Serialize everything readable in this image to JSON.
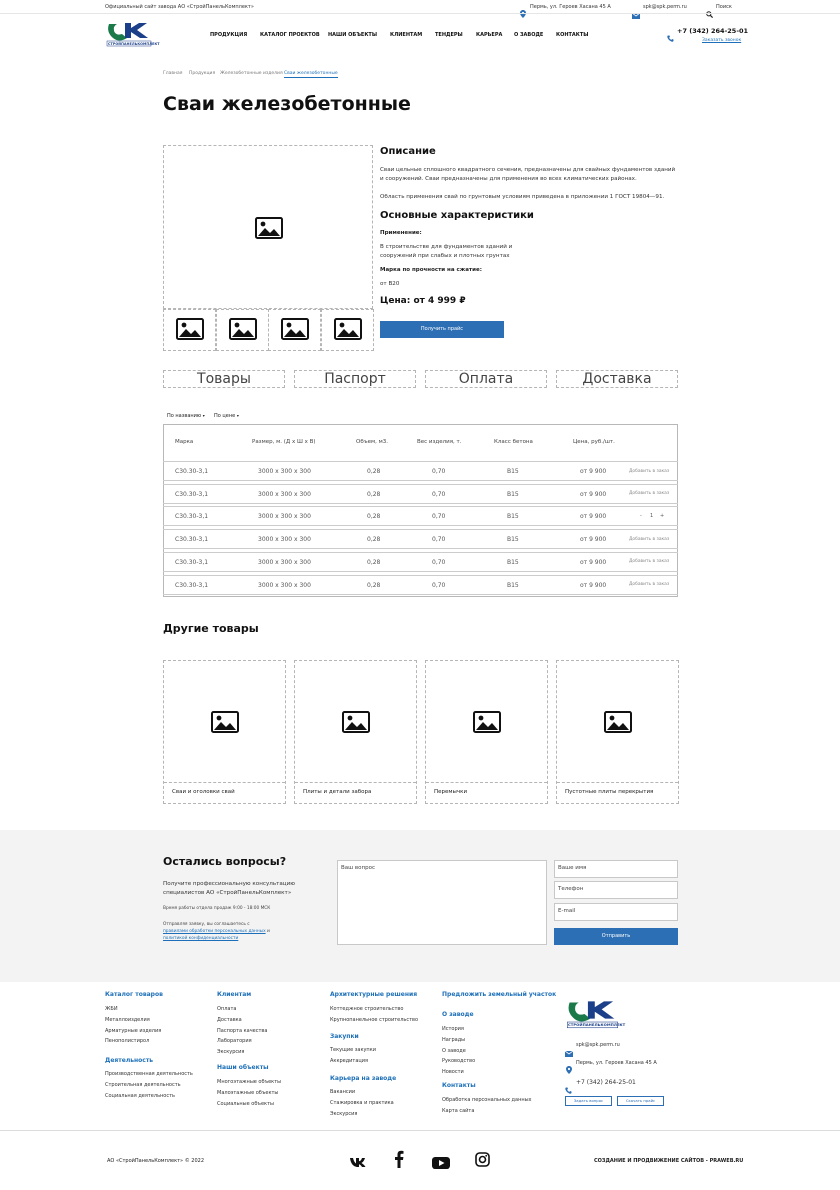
{
  "topbar": {
    "official": "Официальный сайт завода АО «СтройПанельКомплект»",
    "address": "Пермь, ул. Героев Хасана 45 А",
    "email": "spk@spk.perm.ru",
    "search": "Поиск"
  },
  "header": {
    "nav": [
      "ПРОДУКЦИЯ",
      "КАТАЛОГ ПРОЕКТОВ",
      "НАШИ ОБЪЕКТЫ",
      "КЛИЕНТАМ",
      "ТЕНДЕРЫ",
      "КАРЬЕРА",
      "О ЗАВОДЕ",
      "КОНТАКТЫ"
    ],
    "phone": "+7 (342) 264-25-01",
    "callback": "Заказать звонок",
    "logo_text": "СТРОЙПАНЕЛЬКОМПЛЕКТ"
  },
  "breadcrumbs": [
    "Главная",
    "Продукция",
    "Железобетонные изделия",
    "Сваи железобетонные"
  ],
  "page_title": "Сваи железобетонные",
  "product": {
    "desc_title": "Описание",
    "desc_1": "Сваи цельные сплошного квадратного сечения, предназначены для свайных фундаментов зданий и сооружений. Сваи предназначены для применения во всех климатических районах.",
    "desc_2": "Область применения свай по грунтовым условиям приведена в приложении 1 ГОСТ 19804—91.",
    "char_title": "Основные характеристики",
    "usage_label": "Применение:",
    "usage_text": "В строительстве для фундаментов зданий и сооружений при слабых и плотных грунтах",
    "strength_label": "Марка по прочности на сжатие:",
    "strength_value": "от В20",
    "price": "Цена: от 4 999 ₽",
    "button": "Получить прайс"
  },
  "tabs": [
    "Товары",
    "Паспорт",
    "Оплата",
    "Доставка"
  ],
  "sort": {
    "by_name": "По названию",
    "by_price": "По цене"
  },
  "table": {
    "headers": [
      "Марка",
      "Размер, м. (Д х Ш х В)",
      "Объем, м3.",
      "Вес изделия, т.",
      "Класс бетона",
      "Цена, руб./шт."
    ],
    "rows": [
      {
        "mark": "С30.30-3,1",
        "size": "3000 х 300 х 300",
        "vol": "0,28",
        "weight": "0,70",
        "cls": "B15",
        "price": "от 9 900",
        "action": "Добавить в заказ"
      },
      {
        "mark": "С30.30-3,1",
        "size": "3000 х 300 х 300",
        "vol": "0,28",
        "weight": "0,70",
        "cls": "B15",
        "price": "от 9 900",
        "action": "Добавить в заказ"
      },
      {
        "mark": "С30.30-3,1",
        "size": "3000 х 300 х 300",
        "vol": "0,28",
        "weight": "0,70",
        "cls": "B15",
        "price": "от 9 900",
        "action": ""
      },
      {
        "mark": "С30.30-3,1",
        "size": "3000 х 300 х 300",
        "vol": "0,28",
        "weight": "0,70",
        "cls": "B15",
        "price": "от 9 900",
        "action": "Добавить в заказ"
      },
      {
        "mark": "С30.30-3,1",
        "size": "3000 х 300 х 300",
        "vol": "0,28",
        "weight": "0,70",
        "cls": "B15",
        "price": "от 9 900",
        "action": "Добавить в заказ"
      },
      {
        "mark": "С30.30-3,1",
        "size": "3000 х 300 х 300",
        "vol": "0,28",
        "weight": "0,70",
        "cls": "B15",
        "price": "от 9 900",
        "action": "Добавить в заказ"
      }
    ],
    "stepper": {
      "minus": "-",
      "value": "1",
      "plus": "+"
    }
  },
  "other": {
    "title": "Другие товары",
    "items": [
      "Сваи и оголовки свай",
      "Плиты и детали забора",
      "Перемычки",
      "Пустотные плиты перекрытия"
    ]
  },
  "questions": {
    "title": "Остались вопросы?",
    "text": "Получите профессиональную консультацию специалистов АО «СтройПанельКомплект»",
    "hours": "Время работы отдела продаж 9:00 - 18:00 МСК",
    "consent_1": "Отправляя заявку, вы соглашаетесь с",
    "consent_link1": "правилами обработки персональных данных",
    "consent_and": "и",
    "consent_link2": "политикой конфиденциальности",
    "question_placeholder": "Ваш вопрос",
    "name_placeholder": "Ваше имя",
    "phone_placeholder": "Телефон",
    "email_placeholder": "E-mail",
    "submit": "Отправить"
  },
  "footer": {
    "col1": {
      "h1": "Каталог товаров",
      "items1": [
        "ЖБИ",
        "Металлоизделия",
        "Арматурные изделия",
        "Пенополистирол"
      ],
      "h2": "Деятельность",
      "items2": [
        "Производственная деятельность",
        "Строительная деятельность",
        "Социальная деятельность"
      ]
    },
    "col2": {
      "h1": "Клиентам",
      "items1": [
        "Оплата",
        "Доставка",
        "Паспорта качества",
        "Лаборатория",
        "Экскурсия"
      ],
      "h2": "Наши объекты",
      "items2": [
        "Многоэтажные объекты",
        "Малоэтажные объекты",
        "Социальные объекты"
      ]
    },
    "col3": {
      "h1": "Архитектурные решения",
      "items1": [
        "Коттеджное строительство",
        "Крупнопанельное строительство"
      ],
      "h2": "Закупки",
      "items2": [
        "Текущие закупки",
        "Аккредитация"
      ],
      "h3": "Карьера на заводе",
      "items3": [
        "Вакансии",
        "Стажировка и практика",
        "Экскурсия"
      ]
    },
    "col4": {
      "h1": "Предложить земельный участок",
      "h2": "О заводе",
      "items2": [
        "История",
        "Награды",
        "О заводе",
        "Руководство",
        "Новости"
      ],
      "h3": "Контакты",
      "items3": [
        "Обработка персональных данных",
        "Карта сайта"
      ]
    },
    "contacts": {
      "email": "spk@spk.perm.ru",
      "address": "Пермь, ул. Героев Хасана 45 А",
      "phone": "+7 (342) 264-25-01",
      "btn1": "Задать вопрос",
      "btn2": "Скачать прайс"
    },
    "copyright": "АО «СтройПанельКомплект» © 2022",
    "credits": "СОЗДАНИЕ И ПРОДВИЖЕНИЕ САЙТОВ - PRAWEB.RU"
  },
  "colors": {
    "accent": "#1c6fb8",
    "button": "#2d6fb5",
    "logo_green": "#1a7a4a",
    "gray_band": "#f3f3f3"
  }
}
